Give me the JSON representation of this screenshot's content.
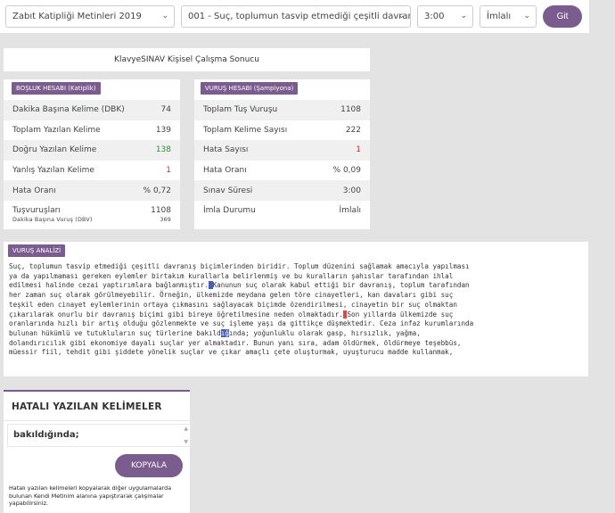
{
  "toolbar": {
    "text_select": "Zabıt Katipliği Metinleri 2019",
    "passage_select": "001 - Suç, toplumun tasvip etmediği çeşitli davranı",
    "time_select": "3:00",
    "mode_select": "İmlalı",
    "go_label": "Git",
    "chevron_icon": "chevron-down-icon"
  },
  "result_title": "KlavyeSINAV Kişisel Çalışma Sonucu",
  "spacing_panel": {
    "badge": "BOŞLUK HESABI (Katiplik)",
    "rows": [
      {
        "label": "Dakika Başına Kelime (DBK)",
        "value": "74"
      },
      {
        "label": "Toplam Yazılan Kelime",
        "value": "139"
      },
      {
        "label": "Doğru Yazılan Kelime",
        "value": "138"
      },
      {
        "label": "Yanlış Yazılan Kelime",
        "value": "1"
      },
      {
        "label": "Hata Oranı",
        "value": "% 0,72"
      },
      {
        "label": "Tuşvuruşları",
        "value": "1108"
      },
      {
        "label": "Dakika Başına Vuruş (DBV)",
        "value": "369"
      }
    ]
  },
  "keystroke_panel": {
    "badge": "VURUŞ HESABI (Şampiyona)",
    "rows": [
      {
        "label": "Toplam Tuş Vuruşu",
        "value": "1108"
      },
      {
        "label": "Toplam Kelime Sayısı",
        "value": "222"
      },
      {
        "label": "Hata Sayısı",
        "value": "1"
      },
      {
        "label": "Hata Oranı",
        "value": "% 0,09"
      },
      {
        "label": "Sınav Süresi",
        "value": "3:00"
      },
      {
        "label": "İmla Durumu",
        "value": "İmlalı"
      }
    ]
  },
  "analysis": {
    "badge": "VURUŞ ANALİZİ",
    "lines": [
      "Suç, toplumun tasvip etmediği çeşitli davranış biçimlerinden biridir. Toplum düzenini sağlamak amacıyla yapılması",
      "ya da yapılmaması gereken eylemler birtakım kurallarla belirlenmiş ve bu kuralların şahıslar tarafından ihlal",
      "edilmesi halinde cezai yaptırımlara bağlanmıştır.",
      "Kanunun suç olarak kabul ettiği bir davranış, toplum tarafından",
      "her zaman suç olarak görülmeyebilir. Örneğin, ülkemizde meydana gelen töre cinayetleri, kan davaları gibi suç",
      "teşkil eden cinayet eylemlerinin ortaya çıkmasını sağlayacak biçimde özendirilmesi, cinayetin bir suç olmaktan",
      "çıkarılarak onurlu bir davranış biçimi gibi bireye öğretilmesine neden olmaktadır.",
      "Son yıllarda ülkemizde suç",
      "oranlarında hızlı bir artış olduğu gözlenmekte ve suç işleme yaşı da gittikçe düşmektedir. Ceza infaz kurumlarında",
      "bulunan hükümlü ve tutukluların suç türlerine bakıld",
      "ığ",
      "ında; yoğunluklu olarak gasp, hırsızlık, yağma,",
      "dolandırıcılık gibi ekonomiye dayalı suçlar yer almaktadır. Bunun yanı sıra, adam öldürmek, öldürmeye teşebbüs,",
      "müessir fiil, tehdit gibi şiddete yönelik suçlar ve çıkar amaçlı çete oluşturmak, uyuşturucu madde kullanmak,"
    ]
  },
  "wrong_words": {
    "title": "HATALI YAZILAN KELİMELER",
    "value": "bakıldığında;",
    "copy_label": "KOPYALA",
    "note": "Hatalı yazılan kelimeleri kopyalarak diğer uygulamalarda bulunan Kendi Metinim alanına yapıştırarak çalışmalar yapabilirsiniz."
  },
  "colors": {
    "accent": "#7b5c8f",
    "correct": "#2e8b3a",
    "error": "#d32a2a",
    "mark_blue": "#4a5fb0",
    "mark_red": "#d64a4a"
  }
}
